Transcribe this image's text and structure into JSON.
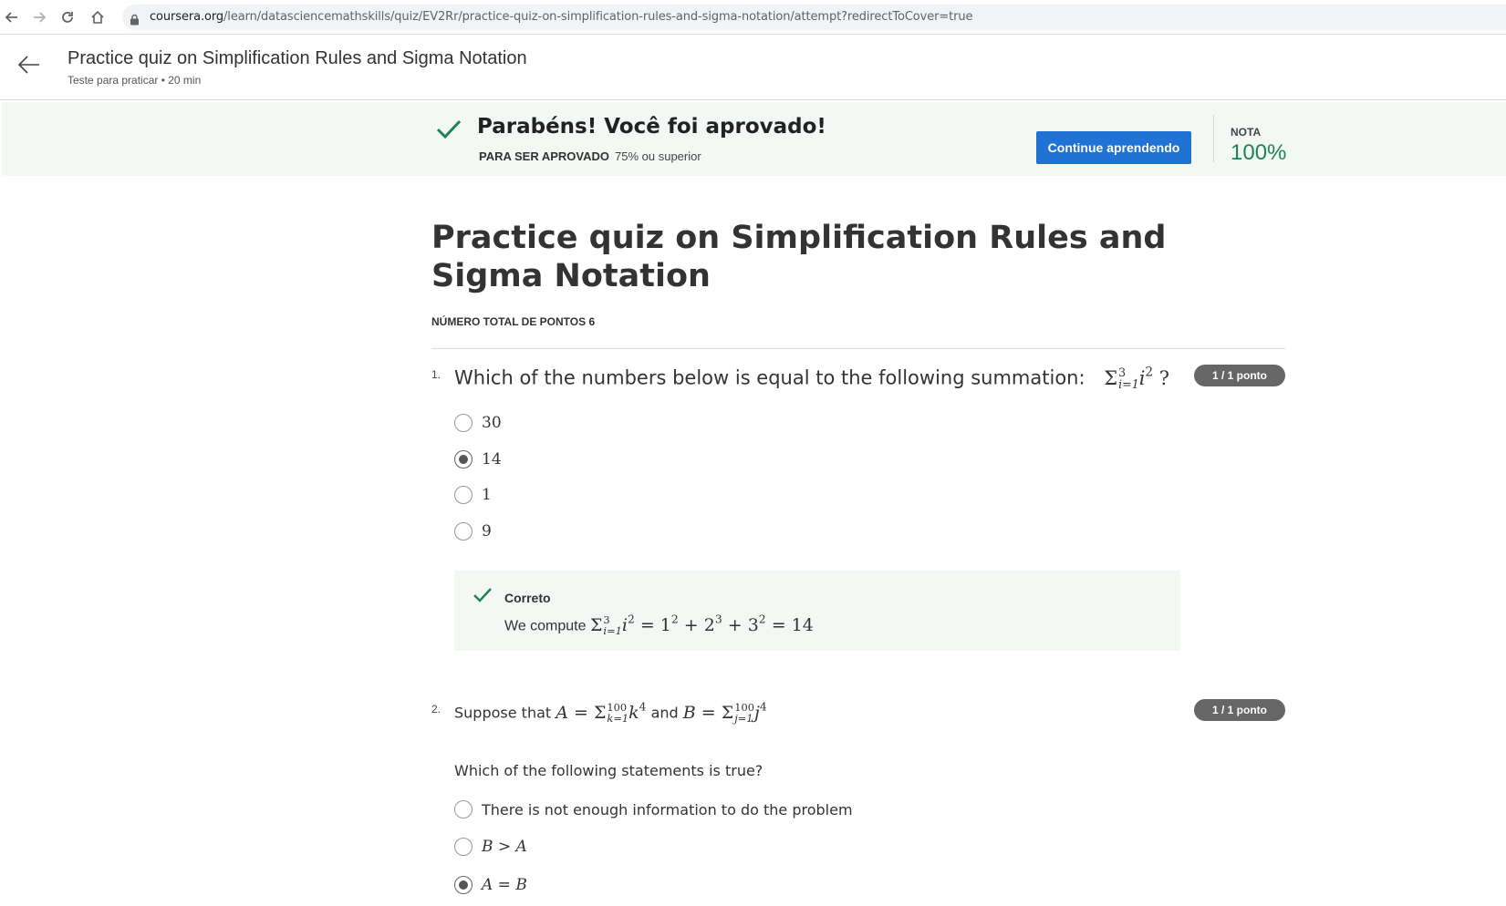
{
  "browser": {
    "url_domain": "coursera.org",
    "url_path": "/learn/datasciencemathskills/quiz/EV2Rr/practice-quiz-on-simplification-rules-and-sigma-notation/attempt?redirectToCover=true"
  },
  "header": {
    "title": "Practice quiz on Simplification Rules and Sigma Notation",
    "subtitle": "Teste para praticar • 20 min"
  },
  "banner": {
    "title": "Parabéns! Você foi aprovado!",
    "requirement_label": "PARA SER APROVADO",
    "requirement_value": "75% ou superior",
    "continue_label": "Continue aprendendo",
    "grade_label": "NOTA",
    "grade_value": "100%"
  },
  "quiz": {
    "title": "Practice quiz on Simplification Rules and Sigma Notation",
    "total_points": "NÚMERO TOTAL DE PONTOS 6"
  },
  "questions": [
    {
      "number": "1.",
      "text": "Which of the numbers below is equal to the following summation:",
      "points": "1 / 1 ponto",
      "options": [
        "30",
        "14",
        "1",
        "9"
      ],
      "selected_index": 1,
      "feedback_title": "Correto",
      "feedback_prefix": "We compute"
    },
    {
      "number": "2.",
      "text_prefix": "Suppose that",
      "text_and": "and",
      "points": "1 / 1 ponto",
      "prompt": "Which of the following statements is true?",
      "options": [
        "There is not enough information to do the problem",
        "B > A",
        "A = B"
      ],
      "selected_index": 2
    }
  ],
  "colors": {
    "accent": "#2073d4",
    "success": "#1f8354",
    "banner_bg": "#f3f8f5"
  }
}
